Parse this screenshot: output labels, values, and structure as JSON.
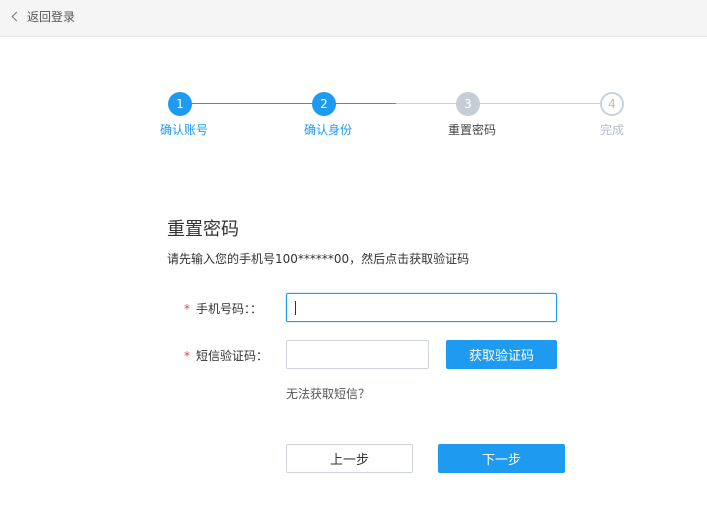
{
  "header": {
    "back_label": "返回登录"
  },
  "steps": [
    {
      "number": "1",
      "label": "确认账号",
      "state": "done"
    },
    {
      "number": "2",
      "label": "确认身份",
      "state": "done"
    },
    {
      "number": "3",
      "label": "重置密码",
      "state": "current"
    },
    {
      "number": "4",
      "label": "完成",
      "state": "todo"
    }
  ],
  "form": {
    "title": "重置密码",
    "subtitle": "请先输入您的手机号100******00，然后点击获取验证码",
    "phone": {
      "required_mark": "*",
      "label": "手机号码：：",
      "value": ""
    },
    "sms": {
      "required_mark": "*",
      "label": "短信验证码：",
      "value": ""
    },
    "get_code_label": "获取验证码",
    "no_sms_link": "无法获取短信？",
    "prev_label": "上一步",
    "next_label": "下一步"
  },
  "colors": {
    "accent": "#1e9bf0",
    "required": "#e64340",
    "pending": "#c5cdd6"
  }
}
